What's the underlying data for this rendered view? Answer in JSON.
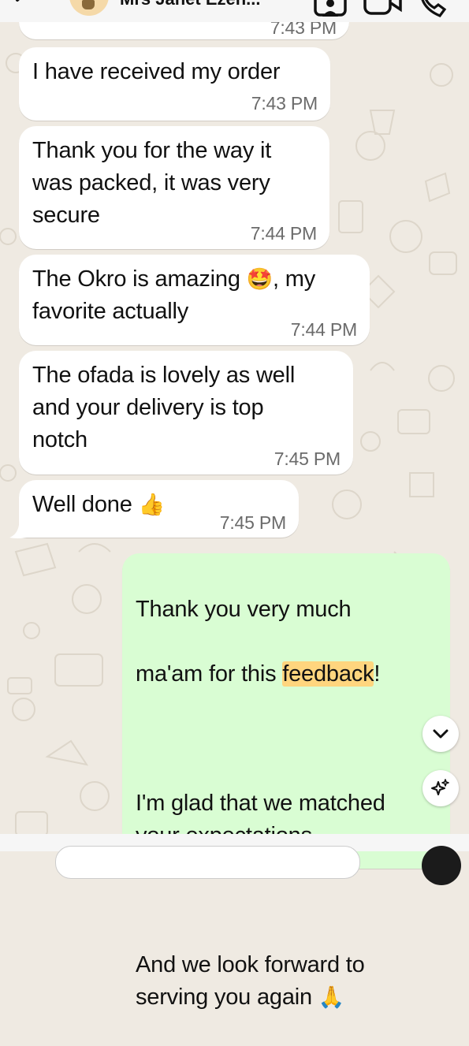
{
  "header": {
    "contact_name": "Mrs Janet Ezeh..."
  },
  "messages": [
    {
      "direction": "in",
      "text": "",
      "time": "7:43 PM"
    },
    {
      "direction": "in",
      "text": "I have received my order",
      "time": "7:43 PM"
    },
    {
      "direction": "in",
      "text": "Thank you for the way it\nwas packed, it was very\nsecure",
      "time": "7:44 PM"
    },
    {
      "direction": "in",
      "text_before": "The Okro is amazing ",
      "emoji": "🤩",
      "text_after": ", my\nfavorite actually",
      "time": "7:44 PM"
    },
    {
      "direction": "in",
      "text": "The ofada is lovely as well\nand your delivery is top\nnotch",
      "time": "7:45 PM"
    },
    {
      "direction": "in",
      "text": "Well done ",
      "emoji": "👍",
      "time": "7:45 PM"
    },
    {
      "direction": "out",
      "line1": "Thank you very much",
      "line2_before": "ma'am for this ",
      "line2_highlight": "feedback",
      "line2_after": "!",
      "para2": "I'm glad that we matched\nyour expectations",
      "para3": "And we look forward to\nserving you again ",
      "emoji": "🙏"
    }
  ],
  "icons": {
    "back": "chevron-left-icon",
    "profile": "contact-card-icon",
    "video": "video-camera-icon",
    "call": "phone-icon",
    "scroll": "chevron-down-icon",
    "ai": "sparkle-icon"
  },
  "colors": {
    "wallpaper": "#efeae2",
    "incoming_bubble": "#ffffff",
    "outgoing_bubble": "#d9fdd3",
    "highlight": "#ffd57e"
  }
}
